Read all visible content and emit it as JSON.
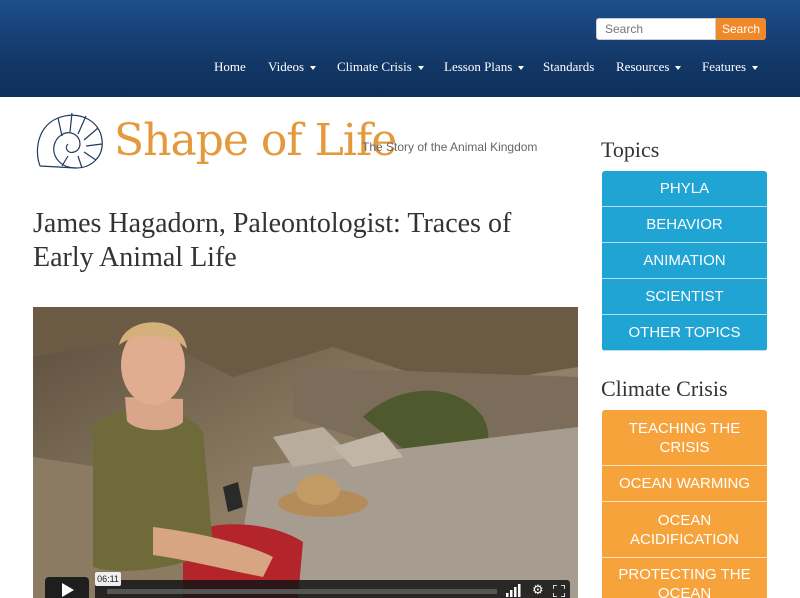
{
  "search": {
    "placeholder": "Search",
    "button_label": "Search"
  },
  "nav": [
    {
      "label": "Home",
      "dropdown": false
    },
    {
      "label": "Videos",
      "dropdown": true
    },
    {
      "label": "Climate Crisis",
      "dropdown": true
    },
    {
      "label": "Lesson Plans",
      "dropdown": true
    },
    {
      "label": "Standards",
      "dropdown": false
    },
    {
      "label": "Resources",
      "dropdown": true
    },
    {
      "label": "Features",
      "dropdown": true
    }
  ],
  "logo": {
    "name": "Shape of Life",
    "tagline": "The Story of the Animal Kingdom"
  },
  "page_title": "James Hagadorn, Paleontologist: Traces of Early Animal Life",
  "video": {
    "time_tooltip": "06:11",
    "icons": [
      "play-icon",
      "volume-icon",
      "settings-icon",
      "fullscreen-icon"
    ]
  },
  "sidebar": {
    "topics_heading": "Topics",
    "topics": [
      "PHYLA",
      "BEHAVIOR",
      "ANIMATION",
      "SCIENTIST",
      "OTHER TOPICS"
    ],
    "climate_heading": "Climate Crisis",
    "climate": [
      "TEACHING THE CRISIS",
      "OCEAN WARMING",
      "OCEAN ACIDIFICATION",
      "PROTECTING THE OCEAN"
    ]
  },
  "colors": {
    "header": "#143a6b",
    "accent_orange": "#f0892a",
    "topics_blue": "#1fa4d4",
    "climate_orange": "#f7a33c",
    "logo_orange": "#e49a3c"
  }
}
